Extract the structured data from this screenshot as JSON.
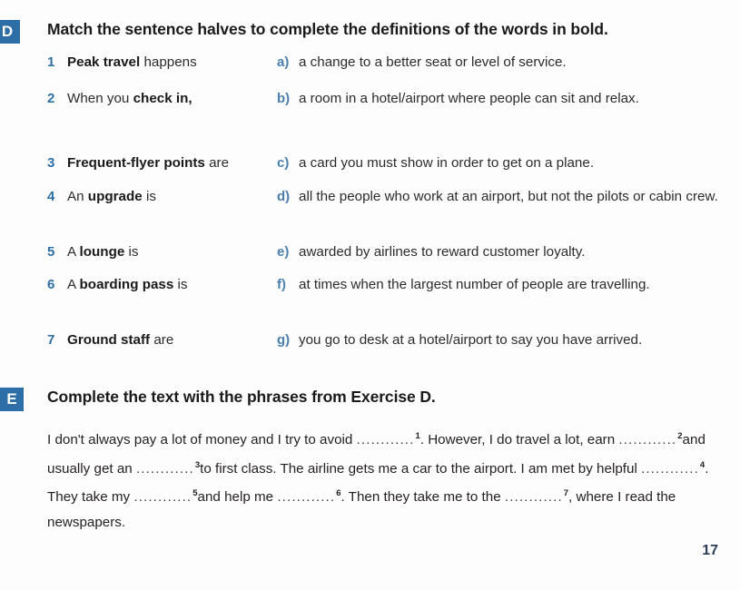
{
  "page": {
    "number": "17"
  },
  "exercise_d": {
    "letter": "D",
    "heading": "Match the sentence halves to complete the definitions of the words in bold.",
    "left_items": [
      {
        "num": "1",
        "pre": "",
        "bold": "Peak travel",
        "post": " happens"
      },
      {
        "num": "2",
        "pre": "When you ",
        "bold": "check in,",
        "post": ""
      },
      {
        "num": "3",
        "pre": "",
        "bold": "Frequent-flyer points",
        "post": " are"
      },
      {
        "num": "4",
        "pre": "An ",
        "bold": "upgrade",
        "post": " is"
      },
      {
        "num": "5",
        "pre": "A ",
        "bold": "lounge",
        "post": " is"
      },
      {
        "num": "6",
        "pre": "A ",
        "bold": "boarding pass",
        "post": " is"
      },
      {
        "num": "7",
        "pre": "",
        "bold": "Ground staff",
        "post": " are"
      }
    ],
    "right_items": [
      {
        "letter": "a)",
        "text": "a change to a better seat or level of service."
      },
      {
        "letter": "b)",
        "text": "a room in a hotel/airport where people can sit and relax."
      },
      {
        "letter": "c)",
        "text": "a card you must show in order to get on a plane."
      },
      {
        "letter": "d)",
        "text": "all the people who work at an airport, but not the pilots or cabin crew."
      },
      {
        "letter": "e)",
        "text": "awarded by airlines to reward customer loyalty."
      },
      {
        "letter": "f)",
        "text": "at times when the largest number of people are travelling."
      },
      {
        "letter": "g)",
        "text": "you go to desk at a hotel/airport to say you have arrived."
      }
    ]
  },
  "exercise_e": {
    "letter": "E",
    "heading": "Complete the text with the phrases from Exercise D.",
    "gap_dots": "............",
    "text_segments": [
      {
        "text": "I don't always pay a lot of money and I try to avoid"
      },
      {
        "gap": "1"
      },
      {
        "text": ". However, I do travel a lot, earn"
      },
      {
        "gap": "2"
      },
      {
        "text": "and usually get an"
      },
      {
        "gap": "3"
      },
      {
        "text": "to first class. The airline gets me a car to the airport. I am met by helpful"
      },
      {
        "gap": "4"
      },
      {
        "text": ". They take my"
      },
      {
        "gap": "5"
      },
      {
        "text": "and help me"
      },
      {
        "gap": "6"
      },
      {
        "text": ". Then they take me to the"
      },
      {
        "gap": "7"
      },
      {
        "text": ", where I read the newspapers."
      }
    ]
  },
  "colors": {
    "badge_background": "#2e6ea6",
    "number_accent": "#2e6ea6",
    "letter_accent": "#4a7fae",
    "page_number": "#2c3d57",
    "body_text": "#231f20"
  }
}
